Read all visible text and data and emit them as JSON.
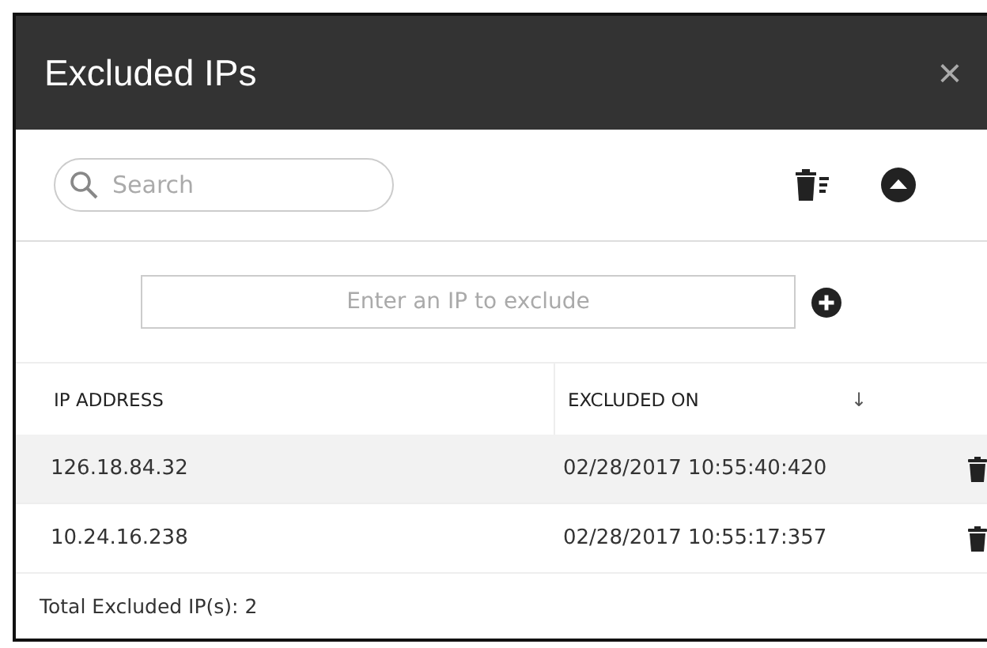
{
  "dialog": {
    "title": "Excluded IPs",
    "close": "×"
  },
  "toolbar": {
    "search": {
      "placeholder": "Search"
    }
  },
  "add_row": {
    "ip_field": {
      "placeholder": "Enter an IP to exclude"
    }
  },
  "table": {
    "columns": [
      {
        "label": "IP ADDRESS"
      },
      {
        "label": "EXCLUDED ON",
        "sort": "↓"
      }
    ],
    "rows": [
      {
        "ip": "126.18.84.32",
        "excluded_on": "02/28/2017 10:55:40:420",
        "selected": true
      },
      {
        "ip": "10.24.16.238",
        "excluded_on": "02/28/2017 10:55:17:357",
        "selected": false
      }
    ]
  },
  "footer": {
    "total": "Total Excluded IP(s): 2"
  }
}
